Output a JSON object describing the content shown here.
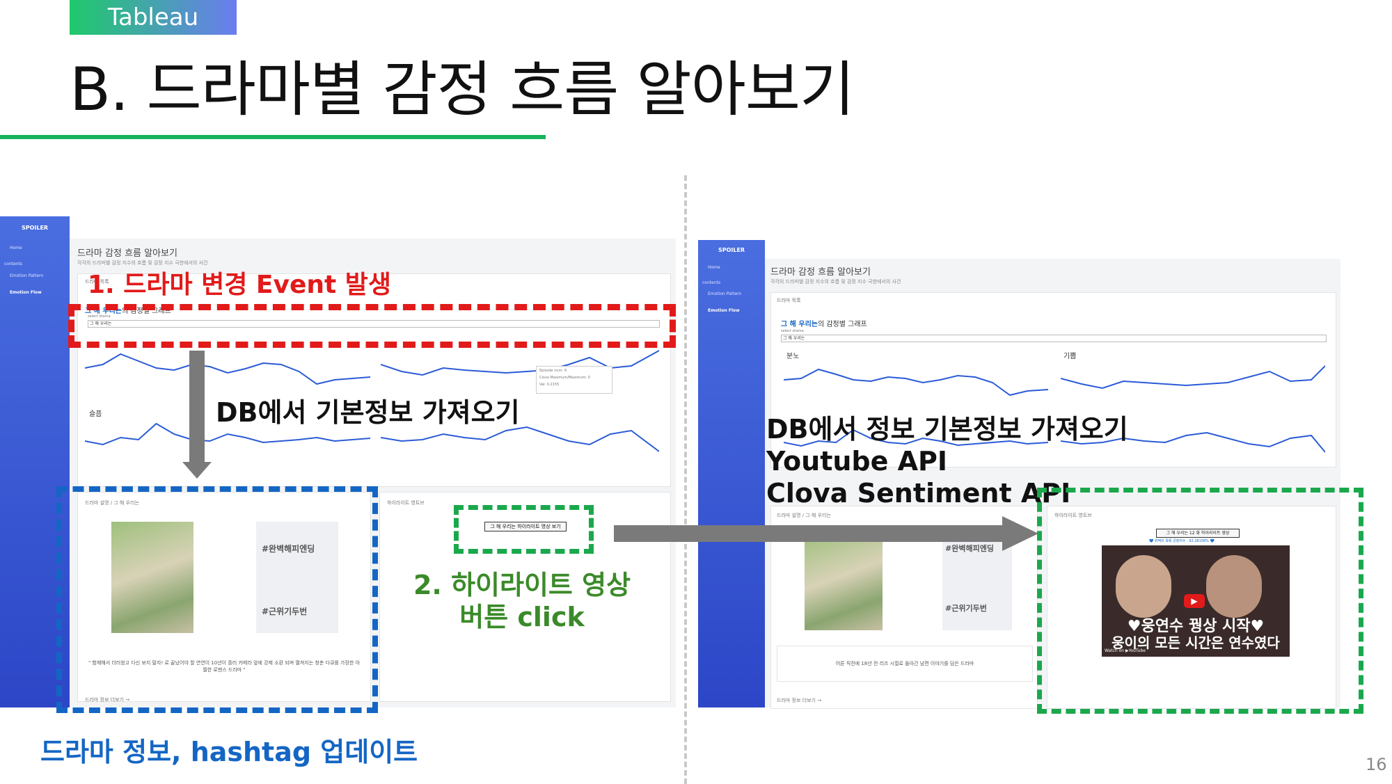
{
  "header": {
    "tag": "Tableau",
    "title": "B. 드라마별 감정 흐름 알아보기"
  },
  "page_number": "16",
  "dashboard": {
    "logo": "SPOILER",
    "nav_home": "Home",
    "nav_section": "contents",
    "nav_pattern": "Emotion Pattern",
    "nav_flow": "Emotion Flow",
    "title": "드라마 감정 흐름 알아보기",
    "subtitle": "각각의 드라마별 감정 지수의 흐름 및 감정 지수 극한에서의 사건",
    "list_label": "드라마 목록",
    "graph_title_drama": "그 해 우리는",
    "graph_title_suffix": "의 감정별 그래프",
    "select_label": "select drama",
    "select_value": "그 해 우리는",
    "chart_anger": "분노",
    "chart_joy": "기쁨",
    "chart_sad": "슬픔",
    "info_label": "드라마 설명 / 그 해 우리는",
    "highlight_label": "하이라이트 영트브",
    "highlight_button": "그 해 우리는 하이라이트 영상 보기",
    "hashtag1": "#완벽해피엔딩",
    "hashtag2": "#근위기두번",
    "description_left": "\" 함께해서 더러웠고 다신 보지 말자! 로 끝났어야 할 연연이 10년이 흘러 카메라 앞에 강제 소환 되며 펼쳐지는 청춘 다큐를 가장한 아찔한 로맨스 드라마 \"",
    "description_right": "어른 직전에 18년 전 리즈 시절로 돌아간 남편 이야기를 담은 드라마",
    "more_link": "드라마 정보 더보기 →",
    "video_title": "그 해 우리는 12 화 하이라이트 영상",
    "video_sentiment": "💙 위젝의 목록 긍정지수 : 92.28158% 💙",
    "video_caption1": "♥웅연수 꿩상 시작♥",
    "video_caption2": "웅이의 모든 시간은 연수였다",
    "video_watch": "Watch on ▶YouTube",
    "tooltip_line1": "Episode num: 9",
    "tooltip_line2": "Clova Maximum/Maximum: 0",
    "tooltip_line3": "Val: 0.2155"
  },
  "annotations": {
    "event": "1. 드라마 변경 Event 발생",
    "db_fetch": "DB에서 기본정보 가져오기",
    "hashtag_update": "드라마 정보, hashtag 업데이트",
    "highlight_click_line1": "2. 하이라이트 영상",
    "highlight_click_line2": "버튼 click",
    "db_fetch2": "DB에서 정보 기본정보 가져오기",
    "youtube_api": "Youtube API",
    "clova_api": "Clova Sentiment API"
  },
  "colors": {
    "red": "#e21a1a",
    "blue": "#1466c4",
    "green": "#1aa84c",
    "sidebar": "#3a58d6"
  }
}
